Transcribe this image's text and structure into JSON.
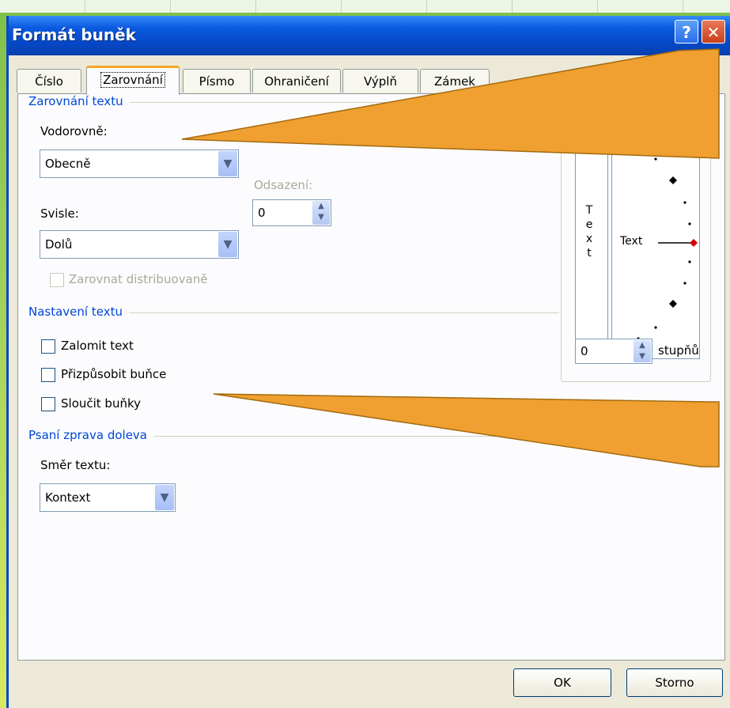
{
  "dialog": {
    "title": "Formát buněk",
    "help_label": "?",
    "close_label": "✕"
  },
  "tabs": [
    {
      "label": "Číslo"
    },
    {
      "label": "Zarovnání"
    },
    {
      "label": "Písmo"
    },
    {
      "label": "Ohraničení"
    },
    {
      "label": "Výplň"
    },
    {
      "label": "Zámek"
    }
  ],
  "alignment": {
    "section_title": "Zarovnání textu",
    "horizontal_label": "Vodorovně:",
    "horizontal_value": "Obecně",
    "indent_label": "Odsazení:",
    "indent_value": "0",
    "vertical_label": "Svisle:",
    "vertical_value": "Dolů",
    "distributed_label": "Zarovnat distribuovaně"
  },
  "text_control": {
    "section_title": "Nastavení textu",
    "wrap_label": "Zalomit text",
    "shrink_label": "Přizpůsobit buňce",
    "merge_label": "Sloučit buňky"
  },
  "rtl": {
    "section_title": "Psaní zprava doleva",
    "direction_label": "Směr textu:",
    "direction_value": "Kontext"
  },
  "orientation": {
    "vertical_text": "Text",
    "dial_text": "Text",
    "degrees_value": "0",
    "degrees_label": "stupňů"
  },
  "buttons": {
    "ok": "OK",
    "cancel": "Storno"
  },
  "colors": {
    "callout": "#f0a030",
    "title_bar": "#0548c6",
    "section_title": "#0046d5",
    "active_tab_accent": "#f5a623"
  }
}
